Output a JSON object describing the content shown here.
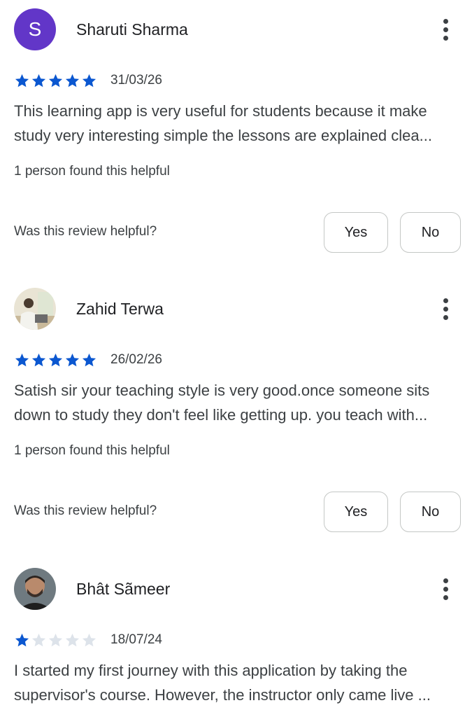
{
  "colors": {
    "star_filled": "#0b57d0",
    "star_empty": "#dde3ea",
    "avatar_purple": "#6236c8"
  },
  "reviews": [
    {
      "author": "Sharuti Sharma",
      "avatar_letter": "S",
      "rating": 5,
      "max_rating": 5,
      "date": "31/03/26",
      "text_line1": "This learning app is very useful for students because it make",
      "text_line2": "study very interesting simple the lessons are explained clea...",
      "helpful_count_text": "1 person found this helpful",
      "helpful_question": "Was this review helpful?",
      "yes_label": "Yes",
      "no_label": "No"
    },
    {
      "author": "Zahid Terwa",
      "rating": 5,
      "max_rating": 5,
      "date": "26/02/26",
      "text_line1": "Satish sir your teaching style is very good.once someone sits",
      "text_line2": "down to study they don't feel like getting up. you teach with...",
      "helpful_count_text": "1 person found this helpful",
      "helpful_question": "Was this review helpful?",
      "yes_label": "Yes",
      "no_label": "No"
    },
    {
      "author": "Bhât Sãmeer",
      "rating": 1,
      "max_rating": 5,
      "date": "18/07/24",
      "text_line1": "I started my first journey with this application by taking the",
      "text_line2": "supervisor's course. However, the instructor only came live ..."
    }
  ]
}
